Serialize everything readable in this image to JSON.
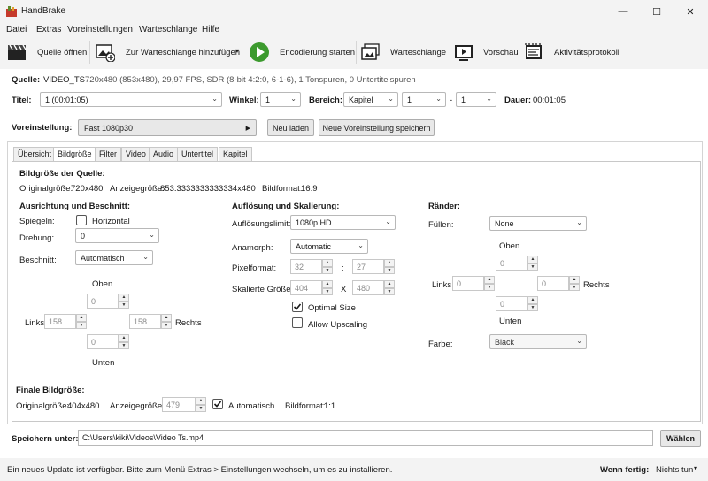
{
  "window": {
    "title": "HandBrake",
    "controls": {
      "minimize": "—",
      "maximize": "☐",
      "close": "✕"
    }
  },
  "menu": [
    "Datei",
    "Extras",
    "Voreinstellungen",
    "Warteschlange",
    "Hilfe"
  ],
  "toolbar": {
    "open_source": "Quelle öffnen",
    "add_queue": "Zur Warteschlange hinzufügen",
    "start_encode": "Encodierung starten",
    "queue": "Warteschlange",
    "preview": "Vorschau",
    "activity_log": "Aktivitätsprotokoll",
    "dropdown_arrow": "▾"
  },
  "source": {
    "label": "Quelle:",
    "name": "VIDEO_TS",
    "info": "720x480 (853x480), 29,97 FPS, SDR (8-bit 4:2:0, 6-1-6), 1 Tonspuren, 0 Untertitelspuren"
  },
  "title_row": {
    "title_label": "Titel:",
    "title_value": "1 (00:01:05)",
    "angle_label": "Winkel:",
    "angle_value": "1",
    "range_label": "Bereich:",
    "range_type": "Kapitel",
    "range_start": "1",
    "range_sep": "-",
    "range_end": "1",
    "duration_label": "Dauer:",
    "duration_value": "00:01:05"
  },
  "preset": {
    "label": "Voreinstellung:",
    "value": "Fast 1080p30",
    "reload": "Neu laden",
    "save_new": "Neue Voreinstellung speichern"
  },
  "tabs": [
    "Übersicht",
    "Bildgröße",
    "Filter",
    "Video",
    "Audio",
    "Untertitel",
    "Kapitel"
  ],
  "active_tab": "Bildgröße",
  "dimensions": {
    "source_heading": "Bildgröße der Quelle:",
    "source_orig_label": "Originalgröße:",
    "source_orig_value": "720x480",
    "source_display_label": "Anzeigegröße:",
    "source_display_value": "853.3333333333334x480",
    "source_aspect_label": "Bildformat:",
    "source_aspect_value": "16:9"
  },
  "orientation": {
    "heading": "Ausrichtung und Beschnitt:",
    "flip_label": "Spiegeln:",
    "flip_option": "Horizontal",
    "rotation_label": "Drehung:",
    "rotation_value": "0",
    "crop_label": "Beschnitt:",
    "crop_value": "Automatisch",
    "top_label": "Oben",
    "top_value": "0",
    "left_label": "Links",
    "left_value": "158",
    "right_value": "158",
    "right_label": "Rechts",
    "bottom_value": "0",
    "bottom_label": "Unten"
  },
  "resolution": {
    "heading": "Auflösung und Skalierung:",
    "limit_label": "Auflösungslimit:",
    "limit_value": "1080p HD",
    "anamorphic_label": "Anamorph:",
    "anamorphic_value": "Automatic",
    "pixel_label": "Pixelformat:",
    "pixel_w": "32",
    "pixel_sep": ":",
    "pixel_h": "27",
    "scaled_label": "Skalierte Größe:",
    "scaled_w": "404",
    "scaled_sep": "X",
    "scaled_h": "480",
    "optimal_label": "Optimal Size",
    "upscale_label": "Allow Upscaling"
  },
  "borders": {
    "heading": "Ränder:",
    "fill_label": "Füllen:",
    "fill_value": "None",
    "top_label": "Oben",
    "top_value": "0",
    "left_label": "Links",
    "left_value": "0",
    "right_value": "0",
    "right_label": "Rechts",
    "bottom_value": "0",
    "bottom_label": "Unten",
    "color_label": "Farbe:",
    "color_value": "Black"
  },
  "final": {
    "heading": "Finale Bildgröße:",
    "orig_label": "Originalgröße:",
    "orig_value": "404x480",
    "display_label": "Anzeigegröße:",
    "display_value": "479",
    "auto_label": "Automatisch",
    "aspect_label": "Bildformat:",
    "aspect_value": "1:1"
  },
  "save": {
    "label": "Speichern unter:",
    "path": "C:\\Users\\kiki\\Videos\\Video Ts.mp4",
    "browse": "Wählen"
  },
  "status": {
    "message": "Ein neues Update ist verfügbar. Bitte zum Menü Extras  > Einstellungen wechseln, um es zu installieren.",
    "when_done_label": "Wenn fertig:",
    "when_done_value": "Nichts tun"
  },
  "colors": {
    "start_green": "#3c9a2e",
    "accent_check": "#1a1a1a"
  }
}
